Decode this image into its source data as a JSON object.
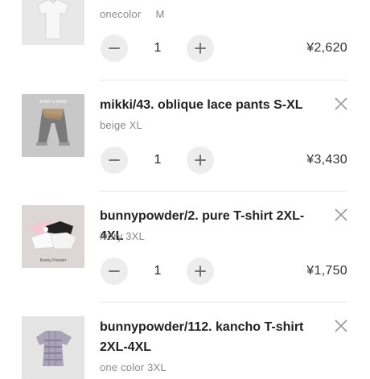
{
  "cart": {
    "items": [
      {
        "title": "",
        "color": "onecolor",
        "size": "M",
        "quantity": "1",
        "price": "¥2,620",
        "thumb_bg": "#e9e9e9"
      },
      {
        "title": "mikki/43. oblique lace pants S-XL",
        "color": "beige XL",
        "size": "",
        "quantity": "1",
        "price": "¥3,430",
        "thumb_bg": "#c9c9c9",
        "thumb_logo": "JCART x MIKKI"
      },
      {
        "title": "bunnypowder/2. pure T-shirt 2XL-4XL",
        "color": "ivory 3XL",
        "size": "",
        "quantity": "1",
        "price": "¥1,750",
        "thumb_bg": "#dcd6d4",
        "thumb_logo": "Bunny Powder"
      },
      {
        "title": "bunnypowder/112. kancho T-shirt 2XL-4XL",
        "color": "one color 3XL",
        "size": "",
        "quantity": "",
        "price": "",
        "thumb_bg": "#e4e4e4"
      }
    ]
  },
  "icons": {
    "minus": "minus-icon",
    "plus": "plus-icon",
    "remove": "close-icon"
  }
}
